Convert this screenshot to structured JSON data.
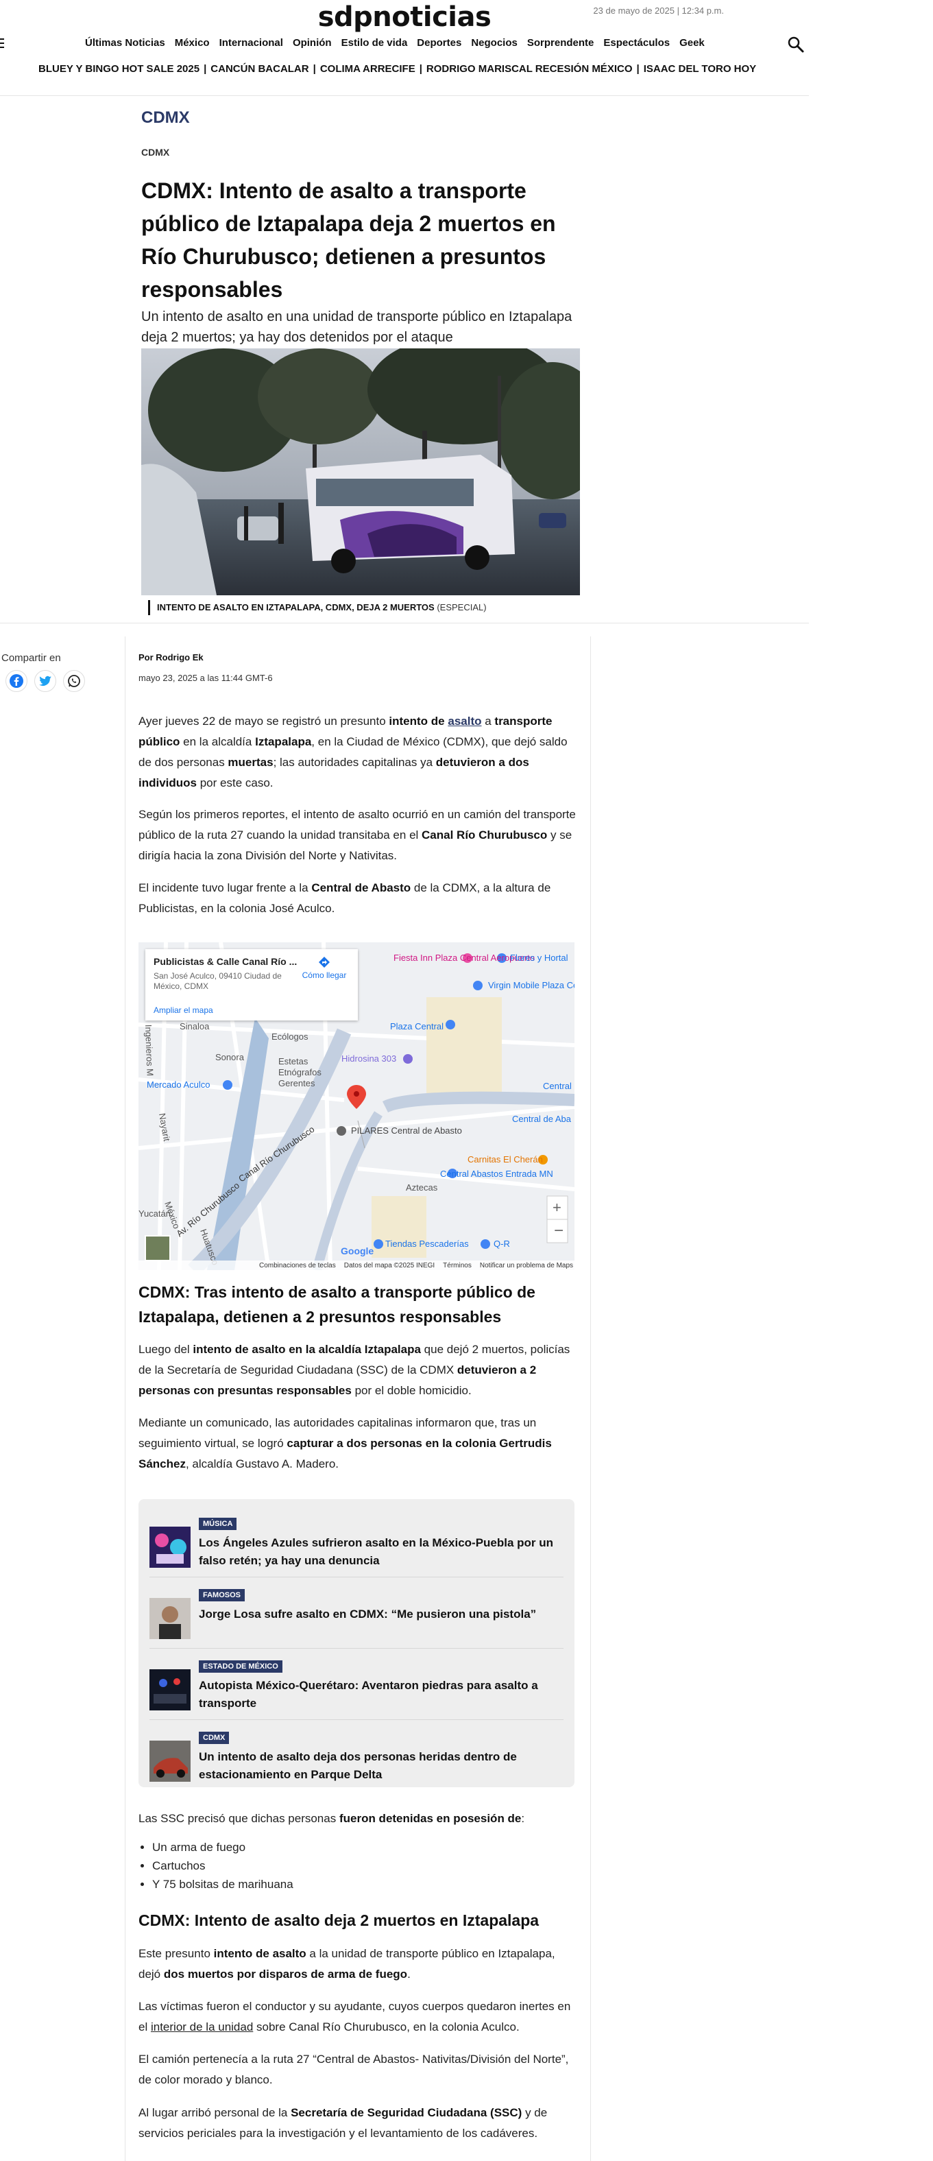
{
  "header": {
    "logo": "sdpnoticias",
    "date": "23 de mayo de 2025 | 12:34 p.m.",
    "nav": [
      "Últimas Noticias",
      "México",
      "Internacional",
      "Opinión",
      "Estilo de vida",
      "Deportes",
      "Negocios",
      "Sorprendente",
      "Espectáculos",
      "Geek"
    ],
    "trends": [
      "BLUEY Y BINGO HOT SALE 2025",
      "CANCÚN BACALAR",
      "COLIMA ARRECIFE",
      "RODRIGO MARISCAL RECESIÓN MÉXICO",
      "ISAAC DEL TORO HOY"
    ]
  },
  "article": {
    "section": "CDMX",
    "category": "CDMX",
    "title": "CDMX: Intento de asalto a transporte público de Iztapalapa deja 2 muertos en Río Churubusco; detienen a presuntos responsables",
    "subtitle": "Un intento de asalto en una unidad de transporte público en Iztapalapa deja 2 muertos; ya hay dos detenidos por el ataque",
    "caption": "INTENTO DE ASALTO EN IZTAPALAPA, CDMX, DEJA 2 MUERTOS",
    "caption_credit": "(ESPECIAL)",
    "share_label": "Compartir en",
    "author": "Por Rodrigo Ek",
    "published": "mayo 23, 2025 a las 11:44 GMT-6",
    "p1": {
      "a": "Ayer jueves 22 de mayo se registró un presunto ",
      "b": "intento de",
      "c": " ",
      "link": "asalto",
      "d": " a ",
      "e": "transporte público",
      "f": " en la alcaldía ",
      "g": "Iztapalapa",
      "h": ", en la Ciudad de México (CDMX), que dejó saldo de dos personas ",
      "i": "muertas",
      "j": "; las autoridades capitalinas ya ",
      "k": "detuvieron a dos individuos",
      "l": " por este caso."
    },
    "p2": {
      "a": "Según los primeros reportes, el intento de asalto ocurrió en un camión del transporte público de la ruta 27 cuando la unidad transitaba en el ",
      "b": "Canal Río Churubusco",
      "c": " y se dirigía hacia la zona División del Norte y Nativitas."
    },
    "p3": {
      "a": "El incidente tuvo lugar frente a la ",
      "b": "Central de Abasto",
      "c": " de la CDMX, a la altura de Publicistas, en la colonia José Aculco."
    },
    "h2a": "CDMX: Tras intento de asalto a transporte público de Iztapalapa, detienen a 2 presuntos responsables",
    "p4": {
      "a": "Luego del ",
      "b": "intento de asalto en la alcaldía Iztapalapa",
      "c": " que dejó 2 muertos, policías de la Secretaría de Seguridad Ciudadana (SSC) de la CDMX ",
      "d": "detuvieron a 2 personas con presuntas responsables",
      "e": " por el doble homicidio."
    },
    "p5": {
      "a": "Mediante un comunicado, las autoridades capitalinas informaron que, tras un seguimiento virtual, se logró ",
      "b": "capturar a dos personas en la colonia Gertrudis Sánchez",
      "c": ", alcaldía Gustavo A. Madero."
    },
    "p6": {
      "a": "Las SSC precisó que dichas personas ",
      "b": "fueron detenidas en posesión de",
      ":": ":"
    },
    "items": [
      "Un arma de fuego",
      "Cartuchos",
      "Y 75 bolsitas de marihuana"
    ],
    "h2b": "CDMX: Intento de asalto deja 2 muertos en Iztapalapa",
    "p7": {
      "a": "Este presunto ",
      "b": "intento de asalto",
      "c": " a la unidad de transporte público en Iztapalapa, dejó ",
      "d": "dos muertos por disparos de arma de fuego",
      "e": "."
    },
    "p8": {
      "a": "Las víctimas fueron el conductor y su ayudante, cuyos cuerpos quedaron inertes en el ",
      "u": "interior de la unidad",
      "b": " sobre Canal Río Churubusco, en la colonia Aculco."
    },
    "p9": "El camión pertenecía a la ruta 27 “Central de Abastos- Nativitas/División del Norte”, de color morado y blanco.",
    "p10": {
      "a": "Al lugar arribó personal de la ",
      "b": "Secretaría de Seguridad Ciudadana (SSC)",
      "c": " y de servicios periciales para la investigación y el levantamiento de los cadáveres."
    }
  },
  "map": {
    "place": "Publicistas & Calle Canal Río ...",
    "address": "San José Aculco, 09410 Ciudad de México, CDMX",
    "directions": "Cómo llegar",
    "enlarge": "Ampliar el mapa",
    "labels": [
      "Fiesta Inn Plaza Central Aeropuerto",
      "Flores y Hortal",
      "Virgin Mobile Plaza Central Iztapalapa",
      "Plaza Central",
      "Hidrosina 303",
      "Mercado Aculco",
      "Sinaloa",
      "Ecólogos",
      "Sonora",
      "Estetas",
      "Etnógrafos",
      "Gerentes",
      "PILARES Central de Abasto",
      "Central",
      "Central de Aba",
      "Carnitas El Cherán",
      "Central Abastos Entrada MN",
      "Aztecas",
      "Canal Río Churubusco",
      "Av. Río Churubusco",
      "Q-R",
      "Tiendas Pescaderías",
      "México",
      "Yucatán",
      "Nayarit",
      "Ingenieros M",
      "Huatusco"
    ],
    "footer": [
      "Combinaciones de teclas",
      "Datos del mapa ©2025 INEGI",
      "Términos",
      "Notificar un problema de Maps"
    ],
    "google": "Google"
  },
  "related": [
    {
      "tag": "MÚSICA",
      "title": "Los Ángeles Azules sufrieron asalto en la México-Puebla por un falso retén; ya hay una denuncia"
    },
    {
      "tag": "FAMOSOS",
      "title": "Jorge Losa sufre asalto en CDMX: “Me pusieron una pistola”"
    },
    {
      "tag": "ESTADO DE MÉXICO",
      "title": "Autopista México-Querétaro: Aventaron piedras para asalto a transporte"
    },
    {
      "tag": "CDMX",
      "title": "Un intento de asalto deja dos personas heridas dentro de estacionamiento en Parque Delta"
    }
  ],
  "colors": {
    "accent": "#2b3a67",
    "badge": "#2b3a67"
  }
}
